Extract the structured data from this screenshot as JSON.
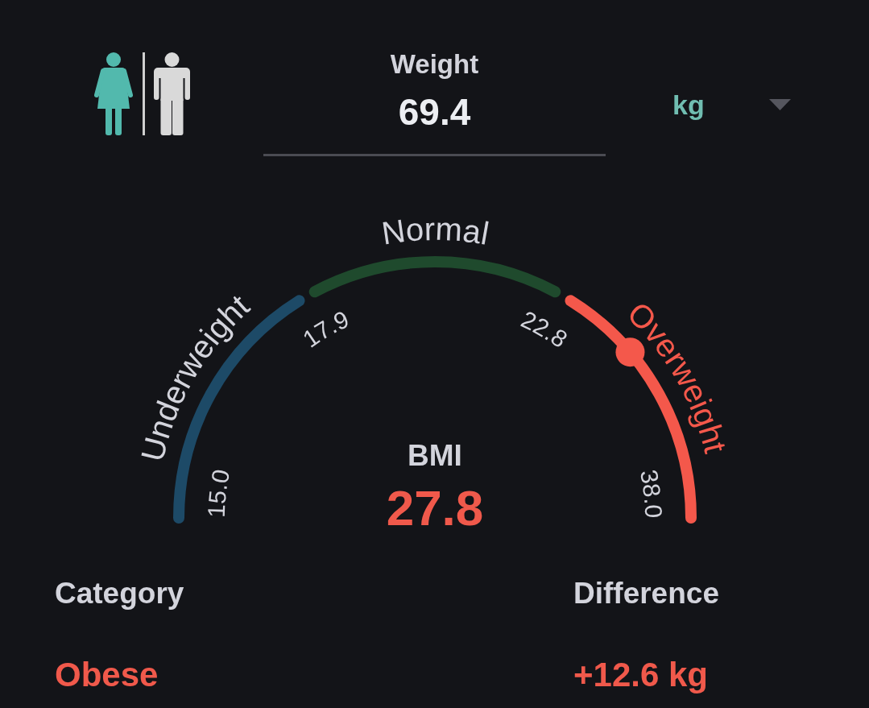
{
  "gender": [
    {
      "kind": "female",
      "selected": true
    },
    {
      "kind": "male",
      "selected": false
    }
  ],
  "weight": {
    "label": "Weight",
    "value": "69.4"
  },
  "unit_dropdown": {
    "value": "kg"
  },
  "gauge": {
    "segments": [
      {
        "label": "Underweight",
        "color": "#1d4a67",
        "selected": false
      },
      {
        "label": "Normal",
        "color": "#1f4a2d",
        "selected": false
      },
      {
        "label": "Overweight",
        "color": "#f4584b",
        "selected": true
      }
    ],
    "ticks": [
      "15.0",
      "17.9",
      "22.8",
      "38.0"
    ],
    "level": 0.776,
    "label": "BMI",
    "value": "27.8"
  },
  "results": [
    {
      "label": "Category",
      "value": "Obese"
    },
    {
      "label": "Difference",
      "value": "+12.6 kg"
    }
  ]
}
